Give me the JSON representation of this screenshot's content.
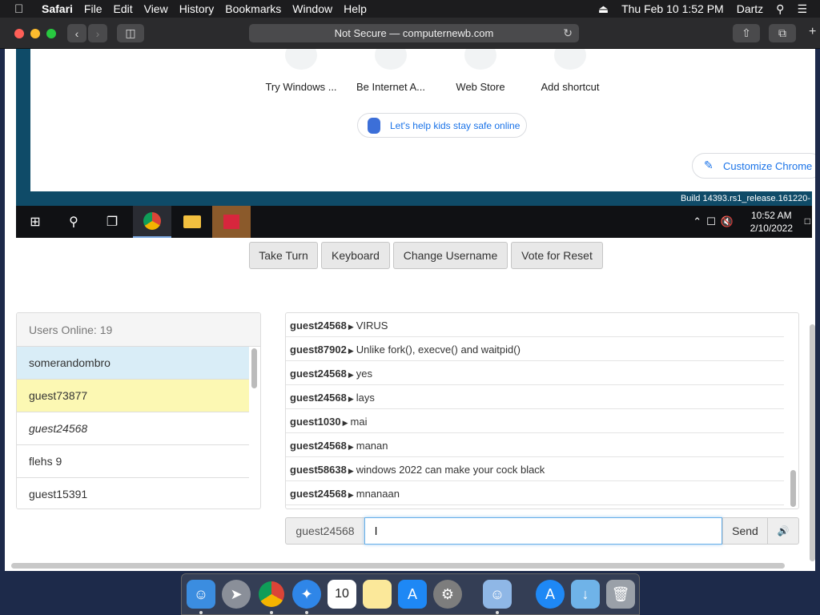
{
  "menubar": {
    "app": "Safari",
    "items": [
      "File",
      "Edit",
      "View",
      "History",
      "Bookmarks",
      "Window",
      "Help"
    ],
    "datetime": "Thu Feb 10  1:52 PM",
    "user": "Dartz",
    "icons": [
      "apple-icon",
      "eject-icon",
      "search-icon",
      "list-icon"
    ]
  },
  "toolbar": {
    "url": "Not Secure — computernewb.com"
  },
  "remote": {
    "shortcuts": [
      "Try Windows ...",
      "Be Internet A...",
      "Web Store",
      "Add shortcut"
    ],
    "kids_banner": "Let's help kids stay safe online",
    "customize": "Customize Chrome",
    "build": "Build 14393.rs1_release.161220-",
    "clock_time": "10:52 AM",
    "clock_date": "2/10/2022"
  },
  "controls": {
    "take_turn": "Take Turn",
    "keyboard": "Keyboard",
    "change_username": "Change Username",
    "vote_reset": "Vote for Reset"
  },
  "users": {
    "header": "Users Online: 19",
    "list": [
      {
        "name": "somerandombro",
        "bg": "#d9edf7"
      },
      {
        "name": "guest73877",
        "bg": "#fcf8b3"
      },
      {
        "name": "guest24568",
        "bg": "#ffffff",
        "me": true
      },
      {
        "name": "flehs 9",
        "bg": "#ffffff"
      },
      {
        "name": "guest15391",
        "bg": "#ffffff"
      }
    ]
  },
  "chat": {
    "messages": [
      {
        "user": "guest24568",
        "text": "VIRUS"
      },
      {
        "user": "guest87902",
        "text": "Unlike fork(), execve() and waitpid()"
      },
      {
        "user": "guest24568",
        "text": "yes"
      },
      {
        "user": "guest24568",
        "text": "lays"
      },
      {
        "user": "guest1030",
        "text": "mai"
      },
      {
        "user": "guest24568",
        "text": "manan"
      },
      {
        "user": "guest58638",
        "text": "windows 2022 can make your cock black"
      },
      {
        "user": "guest24568",
        "text": "mnanaan"
      }
    ]
  },
  "input": {
    "username": "guest24568",
    "value": "l",
    "send": "Send"
  },
  "colors": {
    "highlight_blue": "#d9edf7",
    "highlight_yellow": "#fcf8b3",
    "accent": "#1a73e8"
  }
}
